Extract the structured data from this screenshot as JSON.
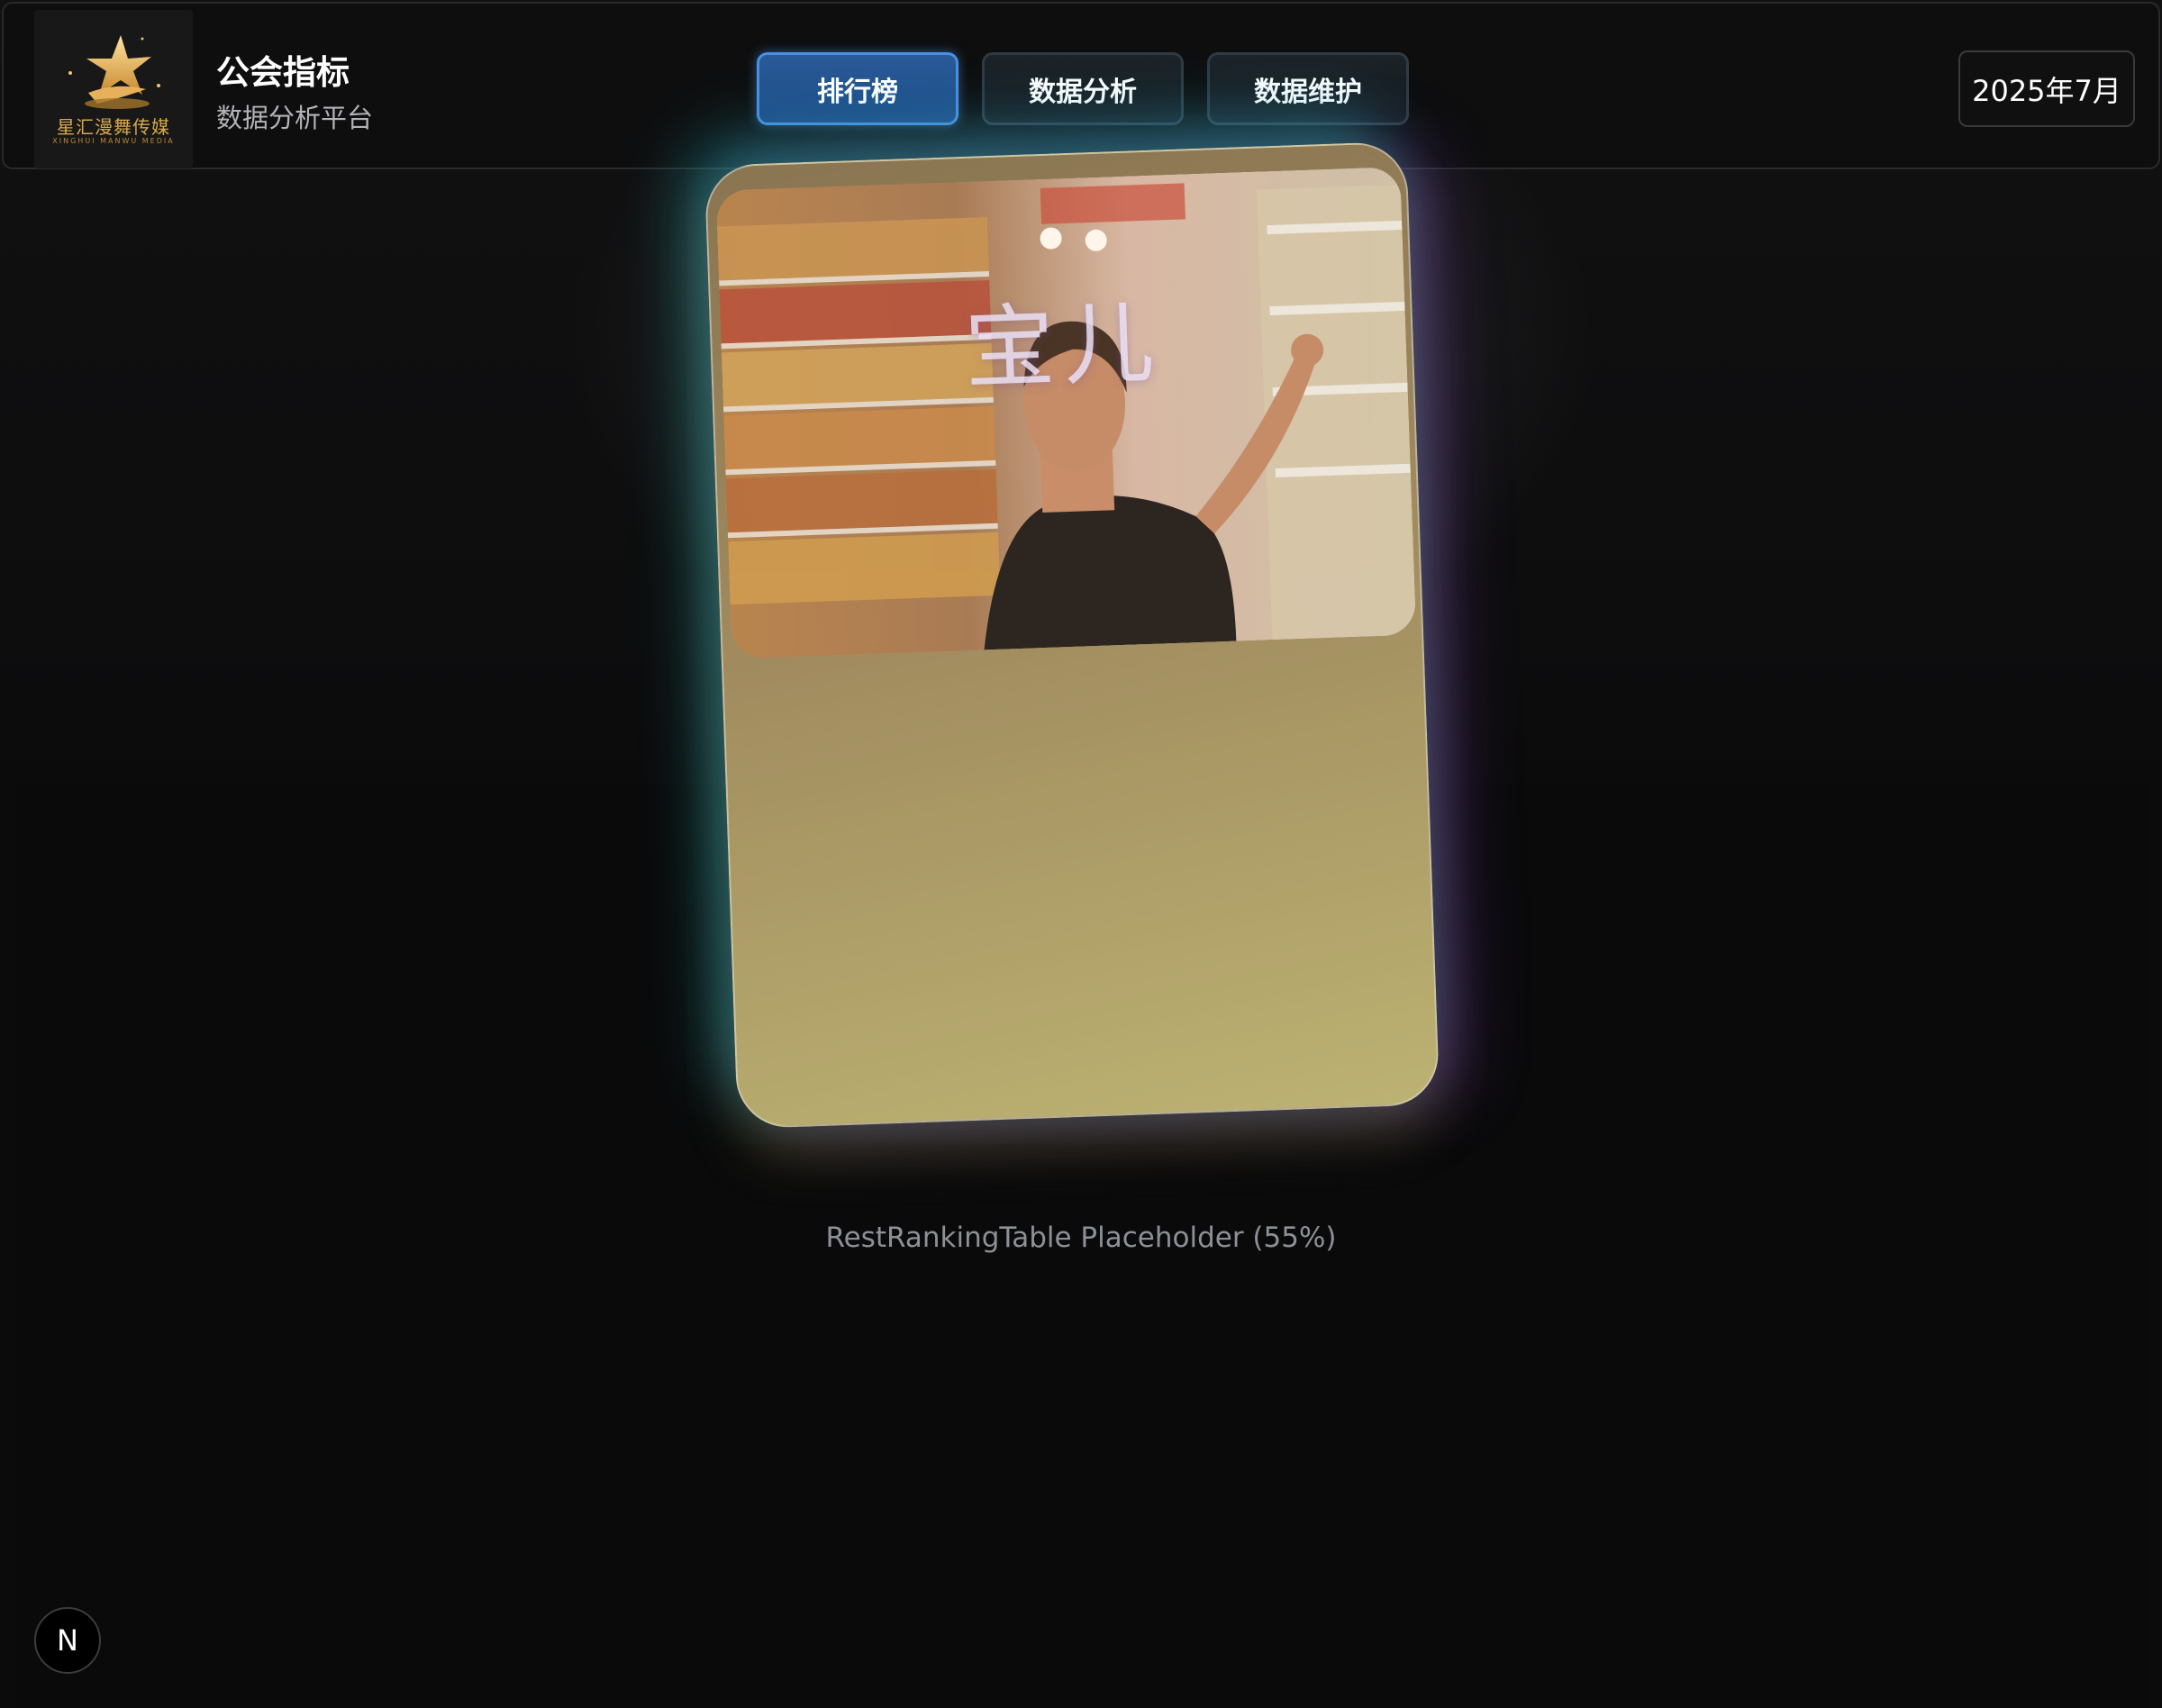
{
  "header": {
    "logo": {
      "icon": "star-logo-icon",
      "text_cn": "星汇漫舞传媒",
      "text_en": "XINGHUI MANWU MEDIA"
    },
    "title": "公会指标",
    "subtitle": "数据分析平台",
    "nav": [
      {
        "label": "排行榜",
        "active": true
      },
      {
        "label": "数据分析",
        "active": false
      },
      {
        "label": "数据维护",
        "active": false
      }
    ],
    "date": "2025年7月"
  },
  "card": {
    "name": "宝儿",
    "photo": "woman-in-supermarket-aisle-photo"
  },
  "placeholder": "RestRankingTable Placeholder (55%)",
  "badge": {
    "label": "N",
    "icon": "nextjs-icon"
  },
  "colors": {
    "accent": "#4a8fe0",
    "background": "#0b0b0c",
    "card_gold": "#bcb272"
  }
}
